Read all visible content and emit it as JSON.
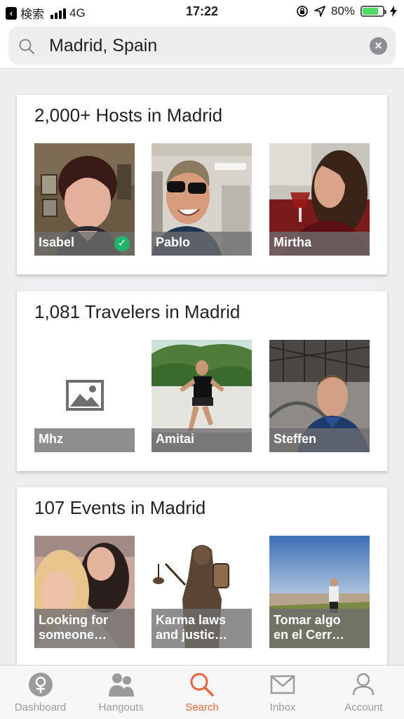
{
  "status_bar": {
    "back_app": "検索",
    "network": "4G",
    "time": "17:22",
    "battery_pct": "80%",
    "battery_level": 0.8
  },
  "search": {
    "value": "Madrid, Spain"
  },
  "hosts": {
    "title": "2,000+ Hosts in Madrid",
    "items": [
      {
        "name": "Isabel",
        "verified": true
      },
      {
        "name": "Pablo"
      },
      {
        "name": "Mirtha"
      }
    ]
  },
  "travelers": {
    "title": "1,081 Travelers in Madrid",
    "items": [
      {
        "name": "Mhz"
      },
      {
        "name": "Amitai"
      },
      {
        "name": "Steffen"
      }
    ]
  },
  "events": {
    "title": "107 Events in Madrid",
    "items": [
      {
        "line1": "Looking for",
        "line2": "someone…"
      },
      {
        "line1": "Karma laws",
        "line2": "and justic…"
      },
      {
        "line1": "Tomar algo",
        "line2": "en el Cerr…"
      }
    ]
  },
  "tabs": [
    {
      "label": "Dashboard",
      "icon": "dashboard-icon"
    },
    {
      "label": "Hangouts",
      "icon": "people-icon"
    },
    {
      "label": "Search",
      "icon": "search-icon",
      "active": true
    },
    {
      "label": "Inbox",
      "icon": "envelope-icon"
    },
    {
      "label": "Account",
      "icon": "user-icon"
    }
  ],
  "colors": {
    "accent": "#e8643a",
    "verified": "#1fb66a",
    "battery": "#4cd964"
  }
}
